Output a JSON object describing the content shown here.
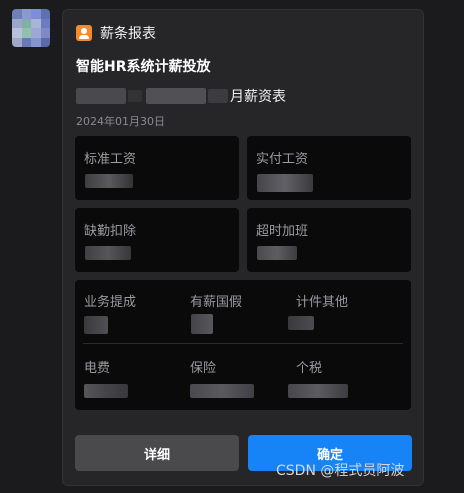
{
  "app": {
    "name": "薪条报表",
    "icon": "person-badge-icon",
    "accent": "#f58b2b"
  },
  "message": {
    "title": "智能HR系统计薪投放",
    "subtitle_suffix": "月薪资表",
    "date": "2024年01月30日"
  },
  "fields": {
    "standard_salary": "标准工资",
    "actual_salary": "实付工资",
    "absence_deduction": "缺勤扣除",
    "overtime": "超时加班",
    "commission": "业务提成",
    "paid_leave": "有薪国假",
    "piece_other": "计件其他",
    "electricity": "电费",
    "insurance": "保险",
    "income_tax": "个税"
  },
  "buttons": {
    "detail": "详细",
    "confirm": "确定"
  },
  "colors": {
    "primary": "#1683f7",
    "secondary_button": "#4a4a4d",
    "card": "#262628",
    "panel": "#0a0a0b"
  },
  "watermark": "CSDN @程式员阿波"
}
